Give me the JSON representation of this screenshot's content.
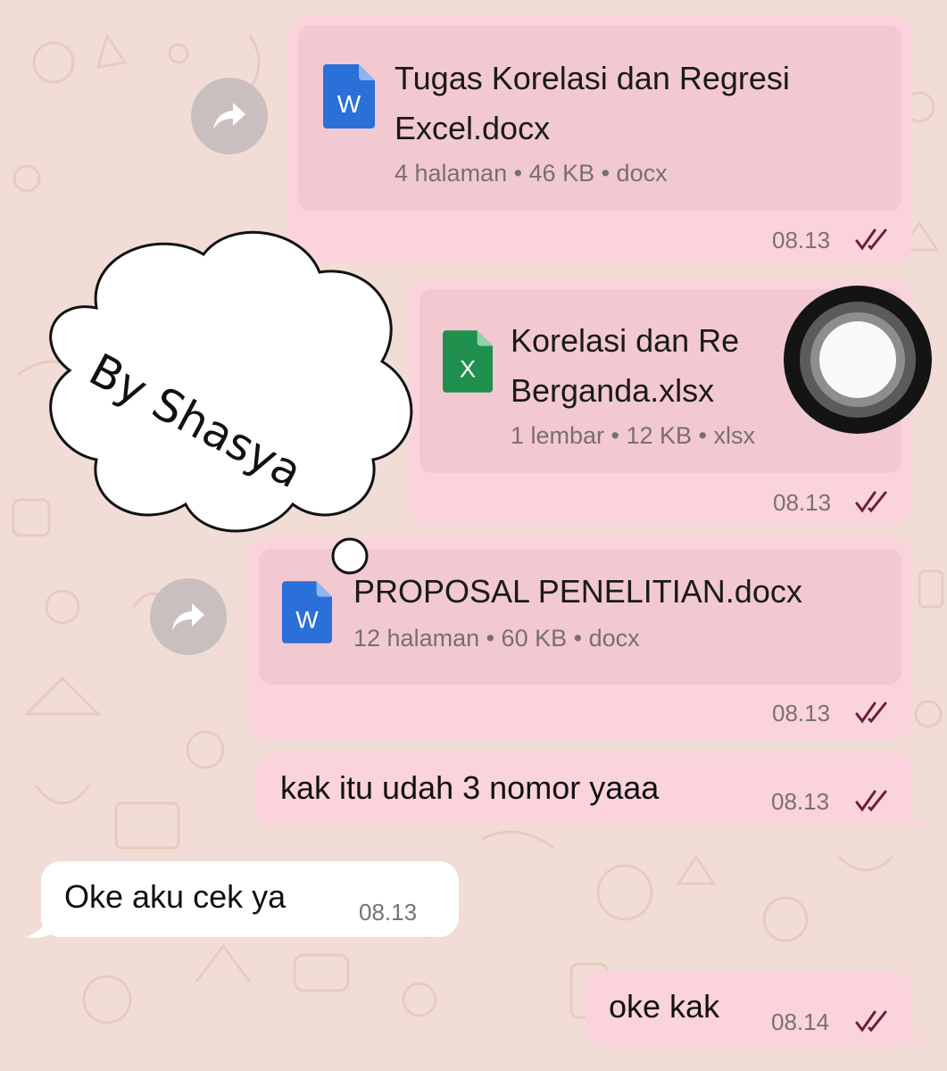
{
  "watermark": "By Shasya",
  "messages": [
    {
      "type": "document",
      "file_name_line1": "Tugas Korelasi dan Regresi",
      "file_name_line2": "Excel.docx",
      "meta": "4 halaman • 46 KB • docx",
      "icon": "word-doc-icon",
      "time": "08.13",
      "status": "read"
    },
    {
      "type": "document",
      "file_name_line1": "Korelasi dan Re",
      "file_name_line2": "Berganda.xlsx",
      "meta": "1 lembar • 12 KB • xlsx",
      "icon": "excel-sheet-icon",
      "time": "08.13",
      "status": "read"
    },
    {
      "type": "document",
      "file_name_line1": "PROPOSAL PENELITIAN.docx",
      "meta": "12 halaman • 60 KB • docx",
      "icon": "word-doc-icon",
      "time": "08.13",
      "status": "read"
    },
    {
      "type": "text",
      "direction": "out",
      "text": "kak itu udah 3 nomor yaaa",
      "time": "08.13",
      "status": "read"
    },
    {
      "type": "text",
      "direction": "in",
      "text": "Oke aku cek ya",
      "time": "08.13"
    },
    {
      "type": "text",
      "direction": "out",
      "text": "oke kak",
      "time": "08.14",
      "status": "read"
    }
  ],
  "colors": {
    "background": "#f1ddd6",
    "outgoing_bubble": "#fbd3dc",
    "document_card": "#f2c9d1",
    "incoming_bubble": "#ffffff",
    "read_ticks": "#6b1e35",
    "word_blue": "#2b6fd8",
    "excel_green": "#1f8f4e"
  }
}
